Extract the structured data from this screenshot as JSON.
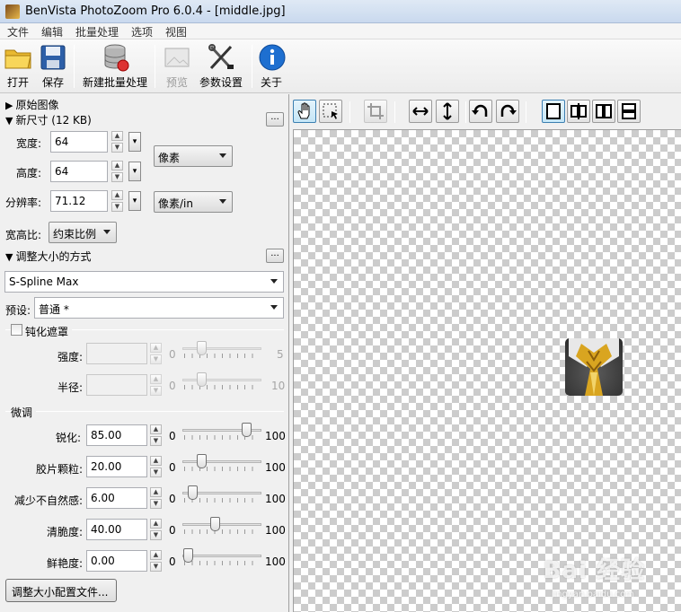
{
  "window": {
    "title": "BenVista PhotoZoom Pro 6.0.4 - [middle.jpg]"
  },
  "menu": [
    "文件",
    "编辑",
    "批量处理",
    "选项",
    "视图"
  ],
  "toolbar": {
    "open": "打开",
    "save": "保存",
    "new_batch": "新建批量处理",
    "preview": "预览",
    "settings": "参数设置",
    "about": "关于"
  },
  "panel": {
    "original_image": "原始图像",
    "new_size": "新尺寸 (12 KB)",
    "more_button": "...",
    "width_label": "宽度:",
    "width_value": "64",
    "height_label": "高度:",
    "height_value": "64",
    "resolution_label": "分辨率:",
    "resolution_value": "71.12",
    "unit_pixels": "像素",
    "unit_resolution": "像素/in",
    "aspect_label": "宽高比:",
    "aspect_value": "约束比例",
    "resize_method": "调整大小的方式",
    "method_value": "S-Spline Max",
    "preset_label": "预设:",
    "preset_value": "普通 *",
    "unsharp_label": "钝化遮罩",
    "strength_label": "强度:",
    "strength_min": "0",
    "strength_max": "5",
    "radius_label": "半径:",
    "radius_min": "0",
    "radius_max": "10",
    "fine_tune": "微调",
    "sharpen_label": "锐化:",
    "sharpen_value": "85.00",
    "grain_label": "胶片颗粒:",
    "grain_value": "20.00",
    "artifact_label": "减少不自然感:",
    "artifact_value": "6.00",
    "crispness_label": "清脆度:",
    "crispness_value": "40.00",
    "vividness_label": "鲜艳度:",
    "vividness_value": "0.00",
    "slider_min": "0",
    "slider_max": "100",
    "profile_button": "调整大小配置文件..."
  },
  "sliders": {
    "sharpen": 0.85,
    "grain": 0.2,
    "artifact": 0.06,
    "crispness": 0.4,
    "vividness": 0.0,
    "strength": 0.2,
    "radius": 0.2
  },
  "watermark": {
    "main": "Bai 经验",
    "sub": "jingyan.baidu.com"
  },
  "colors": {
    "accent": "#3c7fb1",
    "about_icon": "#1e6fd0"
  }
}
